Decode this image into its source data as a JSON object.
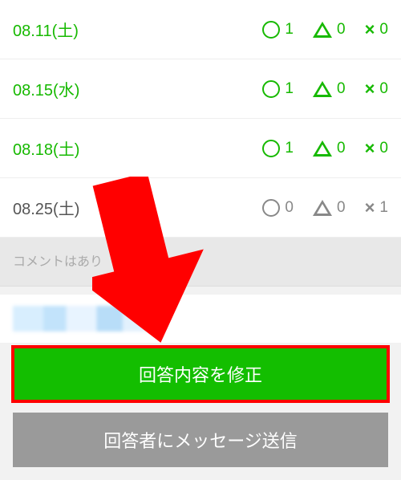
{
  "rows": [
    {
      "date": "08.11(土)",
      "counts": [
        "1",
        "0",
        "0"
      ],
      "style": "green"
    },
    {
      "date": "08.15(水)",
      "counts": [
        "1",
        "0",
        "0"
      ],
      "style": "green"
    },
    {
      "date": "08.18(土)",
      "counts": [
        "1",
        "0",
        "0"
      ],
      "style": "green"
    },
    {
      "date": "08.25(土)",
      "counts": [
        "0",
        "0",
        "1"
      ],
      "style": "gray"
    }
  ],
  "comment_placeholder": "コメントはあり",
  "buttons": {
    "edit": "回答内容を修正",
    "message": "回答者にメッセージ送信"
  }
}
